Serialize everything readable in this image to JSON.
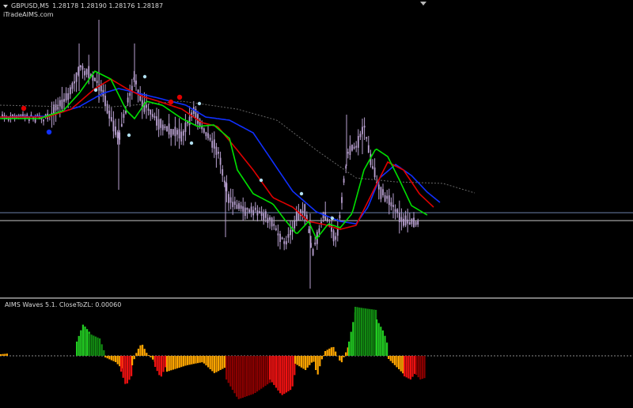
{
  "header": {
    "symbol": "GBPUSD,M5",
    "ohlc": "1.28178 1.28190 1.28176 1.28187",
    "brand": "iTradeAIMS.com"
  },
  "indicator": {
    "title": "AIMS Waves 5.1. CloseToZL: 0.00060"
  },
  "colors": {
    "background": "#000000",
    "candle": "#b8a0d0",
    "ma_fast": "#00e000",
    "ma_mid": "#e00000",
    "ma_slow": "#1030ff",
    "long_ma": "#666666",
    "dot_buy": "#e00000",
    "dot_sell": "#1030ff",
    "dot_neutral": "#b0dff0",
    "hist_orange": "#ffa500",
    "hist_green": "#22cc22",
    "hist_darkgreen": "#128a12",
    "hist_red": "#ee1111",
    "hist_darkred": "#8b0000"
  }
}
